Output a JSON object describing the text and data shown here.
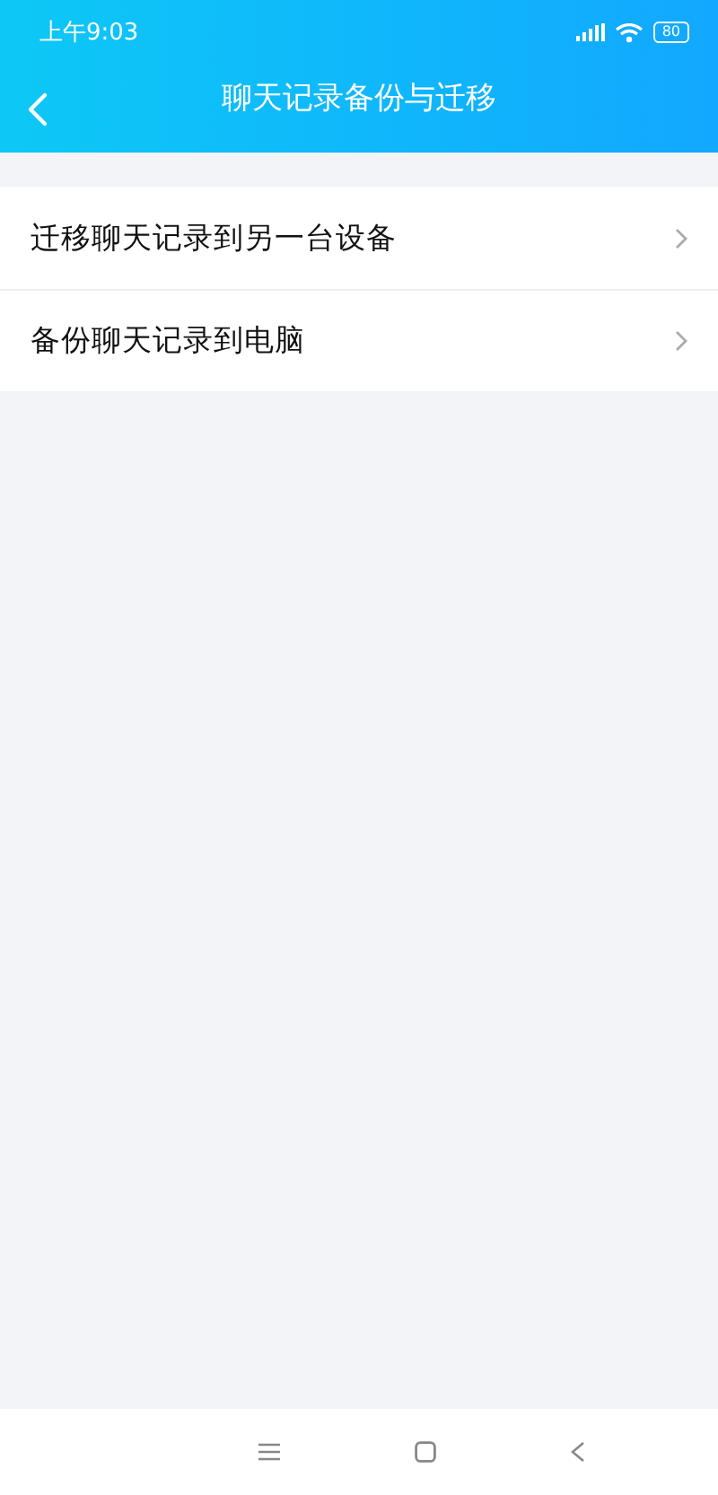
{
  "status_bar": {
    "time": "上午9:03",
    "battery": "80"
  },
  "nav_bar": {
    "title": "聊天记录备份与迁移"
  },
  "items": [
    {
      "label": "迁移聊天记录到另一台设备"
    },
    {
      "label": "备份聊天记录到电脑"
    }
  ]
}
